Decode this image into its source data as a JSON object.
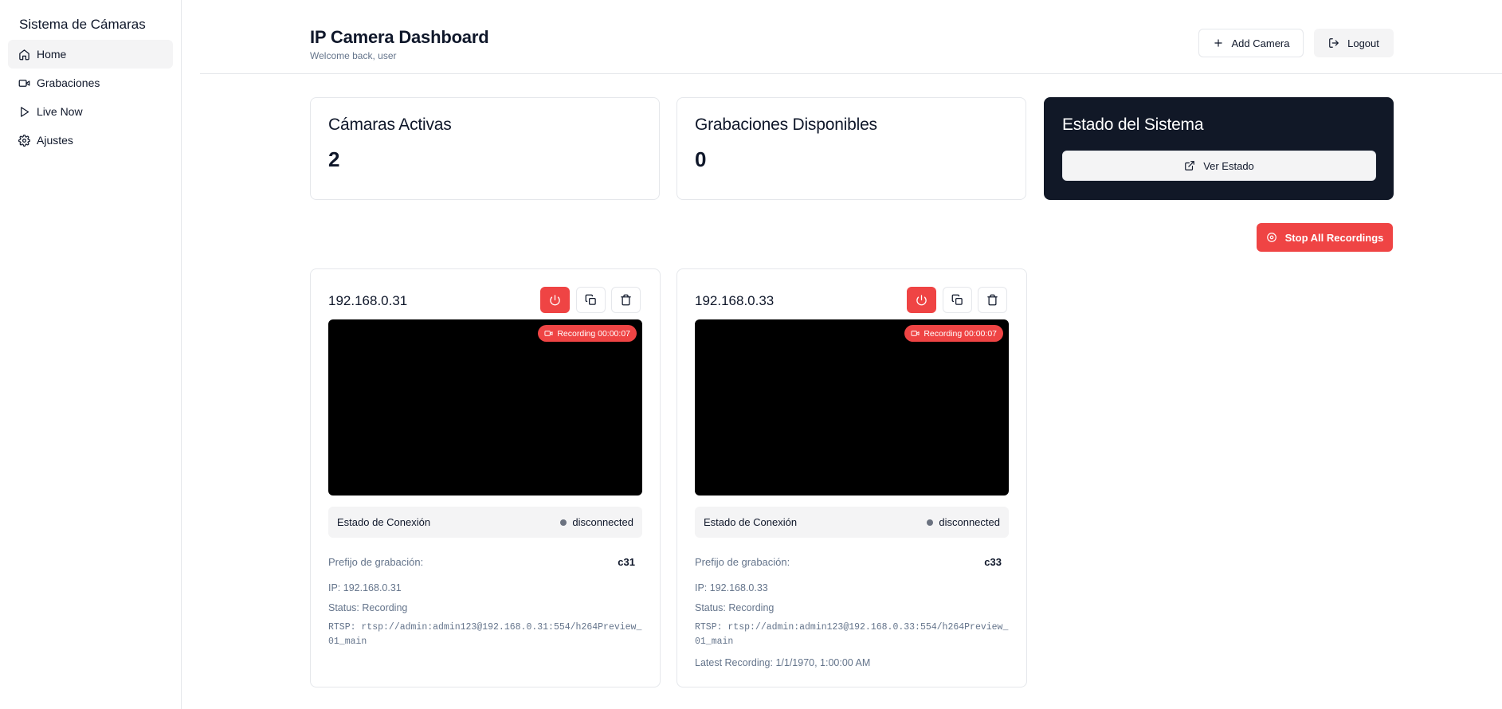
{
  "sidebar": {
    "brand": "Sistema de Cámaras",
    "items": [
      {
        "label": "Home",
        "icon": "home-icon",
        "active": true
      },
      {
        "label": "Grabaciones",
        "icon": "video-icon",
        "active": false
      },
      {
        "label": "Live Now",
        "icon": "play-icon",
        "active": false
      },
      {
        "label": "Ajustes",
        "icon": "gear-icon",
        "active": false
      }
    ]
  },
  "header": {
    "title": "IP Camera Dashboard",
    "subtitle": "Welcome back, user",
    "add_camera_label": "Add Camera",
    "logout_label": "Logout"
  },
  "stats": {
    "active_cameras_label": "Cámaras Activas",
    "active_cameras_value": "2",
    "recordings_label": "Grabaciones Disponibles",
    "recordings_value": "0",
    "system_label": "Estado del Sistema",
    "system_button_label": "Ver Estado"
  },
  "stop_all_label": "Stop All Recordings",
  "colors": {
    "accent_red": "#ef4444",
    "dark_card": "#111827",
    "muted_bg": "#f4f4f5"
  },
  "cameras": [
    {
      "title": "192.168.0.31",
      "recording_badge": "Recording 00:00:07",
      "connection_label": "Estado de Conexión",
      "connection_status": "disconnected",
      "prefix_label": "Prefijo de grabación:",
      "prefix_value": "c31",
      "ip": "IP: 192.168.0.31",
      "status": "Status: Recording",
      "rtsp": "RTSP: rtsp://admin:admin123@192.168.0.31:554/h264Preview_01_main",
      "latest_recording": ""
    },
    {
      "title": "192.168.0.33",
      "recording_badge": "Recording 00:00:07",
      "connection_label": "Estado de Conexión",
      "connection_status": "disconnected",
      "prefix_label": "Prefijo de grabación:",
      "prefix_value": "c33",
      "ip": "IP: 192.168.0.33",
      "status": "Status: Recording",
      "rtsp": "RTSP: rtsp://admin:admin123@192.168.0.33:554/h264Preview_01_main",
      "latest_recording": "Latest Recording: 1/1/1970, 1:00:00 AM"
    }
  ]
}
